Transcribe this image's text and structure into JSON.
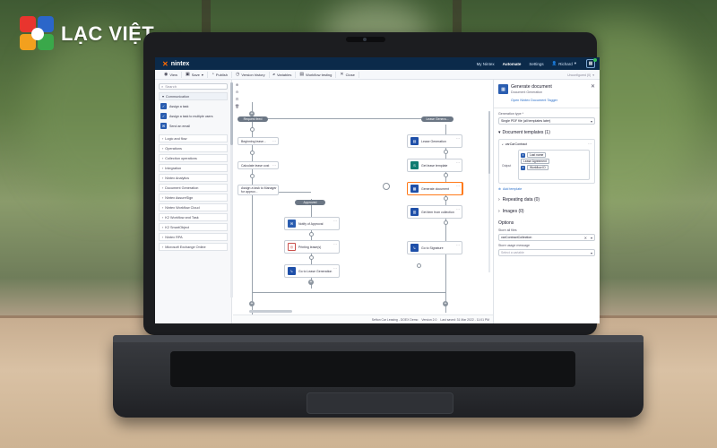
{
  "logo": {
    "text": "LẠC VIỆT"
  },
  "app": {
    "brand": "nintex",
    "topnav": {
      "my_nintex": "My Nintex",
      "automate": "Automate",
      "settings": "Settings",
      "user": "Richard"
    },
    "toolbar": {
      "view": "View",
      "save": "Save",
      "publish": "Publish",
      "version_history": "Version history",
      "variables": "Variables",
      "workflow_testing": "Workflow testing",
      "close": "Close",
      "unconfigured": "Unconfigured (0)"
    },
    "left_panel": {
      "search_placeholder": "Search",
      "open_category": "Communication",
      "actions": [
        "Assign a task",
        "Assign a task to multiple users",
        "Send an email"
      ],
      "categories": [
        "Logic and flow",
        "Operations",
        "Collection operations",
        "Integration",
        "Nintex Analytics",
        "Document Generation",
        "Nintex AssureSign",
        "Nintex Workflow Cloud",
        "K2 Workflow and Task",
        "K2 SmartObject",
        "Nintex RPA",
        "Microsoft Exchange Online"
      ]
    },
    "canvas": {
      "branch_left": "Request feed",
      "branch_right": "Lease Genera...",
      "branch_mid": "Approved",
      "left_nodes": [
        "Beginning lease...",
        "Calculate lease cost",
        "Assign a task to Manager for approv..."
      ],
      "mid_nodes": [
        "Notify of Approval",
        "Printing lease(s)",
        "Go to Lease Generation"
      ],
      "right_nodes": [
        "Lease Generation",
        "Get lease template",
        "Generate document",
        "Get item from collection",
        "Go to Signature"
      ],
      "status": {
        "form": "Sefton Car Leasing - DOEX Demo",
        "version": "Version 2.0",
        "last_saved": "Last saved: 31 Mar 2022 - 11:01 PM"
      }
    },
    "right_panel": {
      "title": "Generate document",
      "subtitle": "Document Generation",
      "open_link": "Open Nintex Document Tagger",
      "generation_type_label": "Generation type *",
      "generation_type_value": "Single PDF file (all templates later)",
      "document_templates": "Document templates (1)",
      "template_var": "varCarContract",
      "output_label": "Output",
      "outputs": [
        "Last name",
        "Lease Agreement",
        "Workflow ID"
      ],
      "add_template": "Add template",
      "repeating_data": "Repeating data (0)",
      "images": "Images (0)",
      "options": "Options",
      "store_files_label": "Store all files",
      "store_files_value": "varContractCollection",
      "store_message_label": "Store usage message",
      "store_message_placeholder": "Select a variable"
    }
  }
}
